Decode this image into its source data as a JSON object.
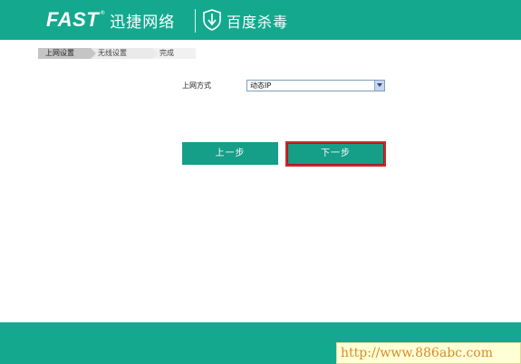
{
  "header": {
    "brand": "FAST",
    "brand_tm": "®",
    "brand_cn": "迅捷网络",
    "partner_icon": "shield-icon",
    "partner": "百度杀毒"
  },
  "steps": [
    "上网设置",
    "无线设置",
    "完成"
  ],
  "form": {
    "connection_label": "上网方式",
    "connection_value": "动态IP"
  },
  "buttons": {
    "prev": "上一步",
    "next": "下一步"
  },
  "watermark": "http://www.886abc.com",
  "colors": {
    "brand_green": "#14a98f",
    "button_green": "#159e88",
    "highlight_red": "#d2262c"
  }
}
